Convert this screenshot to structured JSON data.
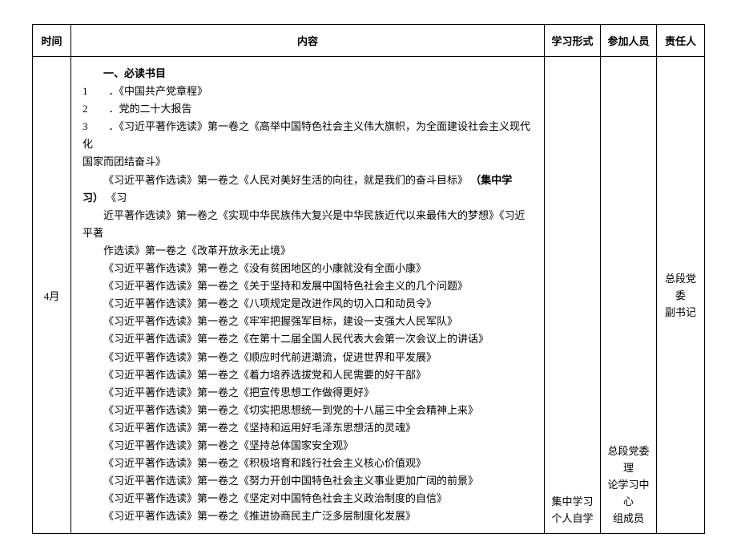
{
  "headers": {
    "time": "时间",
    "content": "内容",
    "form": "学习形式",
    "attendees": "参加人员",
    "responsible": "责任人"
  },
  "row": {
    "time": "4月",
    "content": {
      "heading": "一、必读书目",
      "numbered": [
        "1　　．《中国共产党章程》",
        "2　　．党的二十大报告",
        "3　　．《习近平著作选读》第一卷之《高举中国特色社会主义伟大旗帜，为全面建设社会主义现代化"
      ],
      "numbered_wrap": "国家而团结奋斗》",
      "intro_lines": [
        "《习近平著作选读》第一卷之《人民对美好生活的向往，就是我们的奋斗目标》",
        "近平著作选读》第一卷之《实现中华民族伟大复兴是中华民族近代以来最伟大的梦想》《习近平著",
        "作选读》第一卷之《改革开放永无止境》"
      ],
      "intro_bold": "（集中学习）",
      "intro_after_bold": "《习",
      "items": [
        "《习近平著作选读》第一卷之《没有贫困地区的小康就没有全面小康》",
        "《习近平著作选读》第一卷之《关于坚持和发展中国特色社会主义的几个问题》",
        "《习近平著作选读》第一卷之《八项规定是改进作风的切入口和动员令》",
        "《习近平著作选读》第一卷之《牢牢把握强军目标，建设一支强大人民军队》",
        "《习近平著作选读》第一卷之《在第十二届全国人民代表大会第一次会议上的讲话》",
        "《习近平著作选读》第一卷之《顺应时代前进潮流，促进世界和平发展》",
        "《习近平著作选读》第一卷之《着力培养选拔党和人民需要的好干部》",
        "《习近平著作选读》第一卷之《把宣传思想工作做得更好》",
        "《习近平著作选读》第一卷之《切实把思想统一到党的十八届三中全会精神上来》",
        "《习近平著作选读》第一卷之《坚持和运用好毛泽东思想活的灵魂》",
        "《习近平著作选读》第一卷之《坚持总体国家安全观》",
        "《习近平著作选读》第一卷之《积极培育和践行社会主义核心价值观》",
        "《习近平著作选读》第一卷之《努力开创中国特色社会主义事业更加广阔的前景》",
        "《习近平著作选读》第一卷之《坚定对中国特色社会主义政治制度的自信》",
        "《习近平著作选读》第一卷之《推进协商民主广泛多层制度化发展》"
      ]
    },
    "form_lines": [
      "集中学习",
      "",
      "个人自学"
    ],
    "attendees_lines": [
      "总段党委理",
      "论学习中心",
      "组成员"
    ],
    "responsible_lines": [
      "总段党委",
      "副书记"
    ]
  }
}
